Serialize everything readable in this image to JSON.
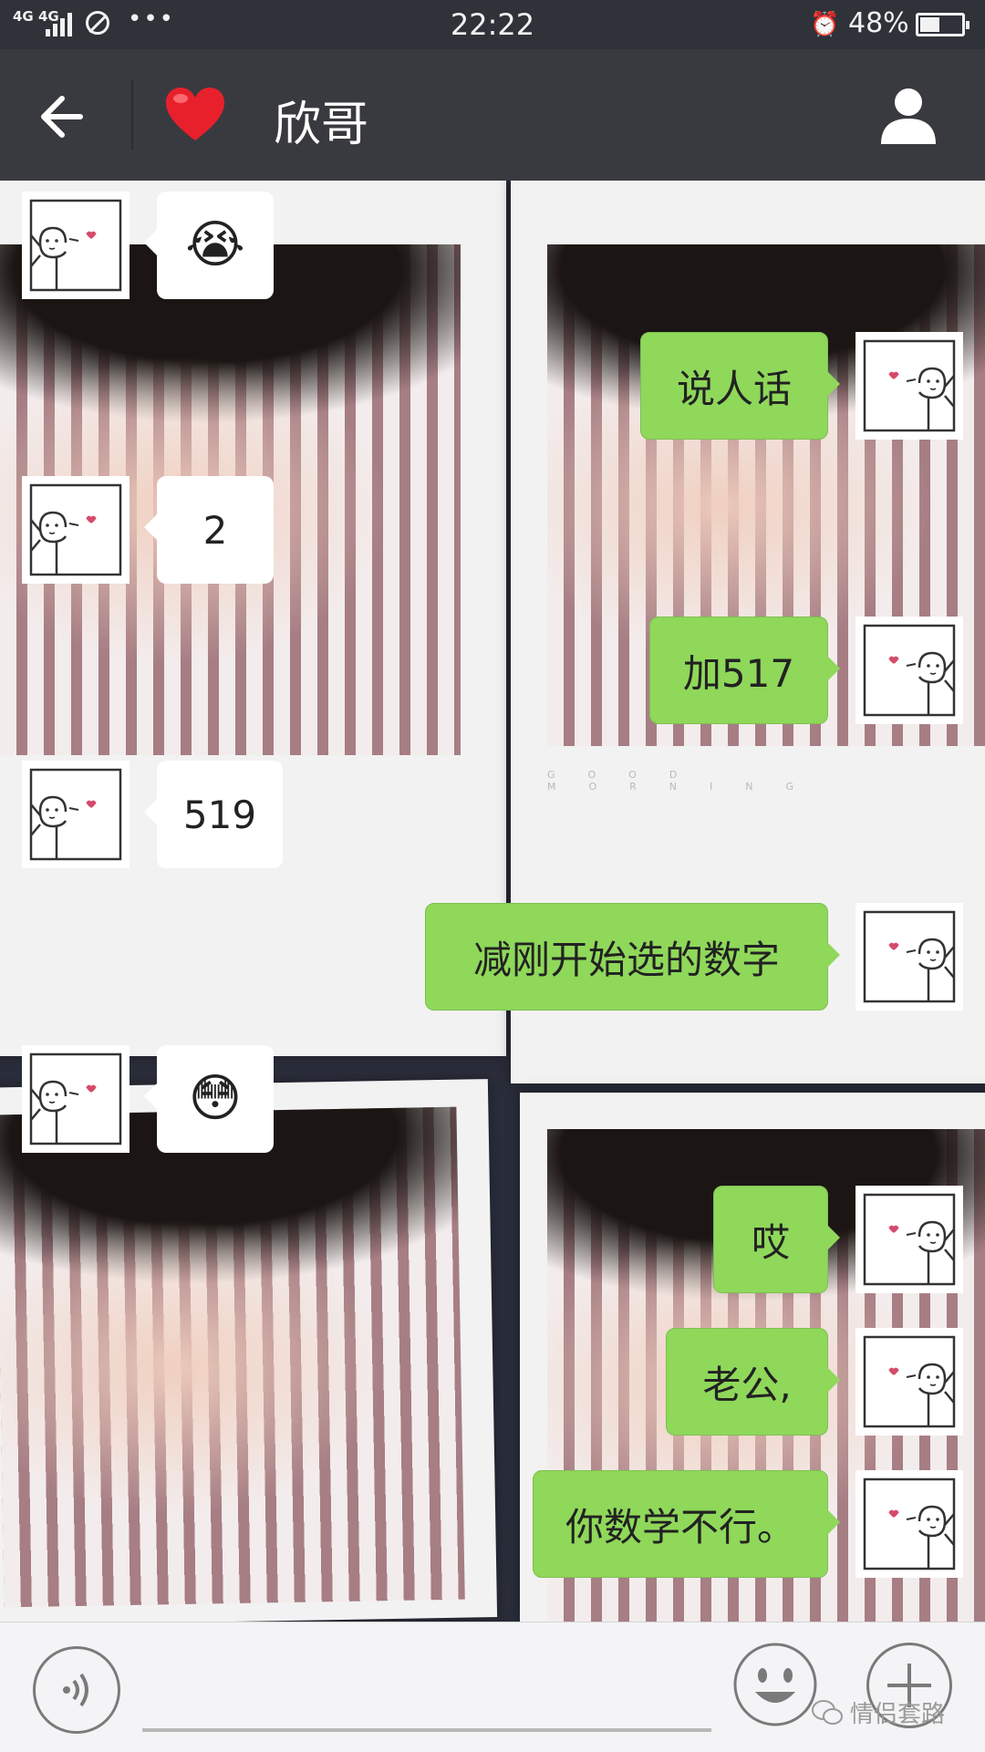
{
  "status_bar": {
    "network": "4G 4G",
    "more": "•••",
    "time": "22:22",
    "alarm_icon": "alarm-clock-icon",
    "battery_text": "48%",
    "battery_level": 0.48
  },
  "header": {
    "back_icon": "back-arrow-icon",
    "heart_icon": "red-heart-icon",
    "title": "欣哥",
    "profile_icon": "person-icon"
  },
  "background": {
    "photo_caption": "GOOD MORNING"
  },
  "messages": [
    {
      "side": "left",
      "type": "emoji",
      "content": "😭",
      "icon": "crying-face-emoji"
    },
    {
      "side": "right",
      "type": "text",
      "content": "说人话"
    },
    {
      "side": "left",
      "type": "text",
      "content": "2"
    },
    {
      "side": "right",
      "type": "text",
      "content": "加517"
    },
    {
      "side": "left",
      "type": "text",
      "content": "519"
    },
    {
      "side": "right",
      "type": "text",
      "content": "减刚开始选的数字"
    },
    {
      "side": "left",
      "type": "emoji",
      "content": "😳",
      "icon": "flushed-face-emoji"
    },
    {
      "side": "right",
      "type": "text",
      "content": "哎"
    },
    {
      "side": "right",
      "type": "text",
      "content": "老公,"
    },
    {
      "side": "right",
      "type": "text",
      "content": "你数学不行。"
    }
  ],
  "input_bar": {
    "voice_icon": "voice-icon",
    "emoji_icon": "smiley-icon",
    "plus_icon": "plus-icon",
    "watermark": "情侣套路",
    "watermark_icon": "wechat-icon"
  },
  "colors": {
    "header_bg": "#393a3f",
    "outgoing_bubble": "#8fd85a",
    "incoming_bubble": "#ffffff"
  }
}
